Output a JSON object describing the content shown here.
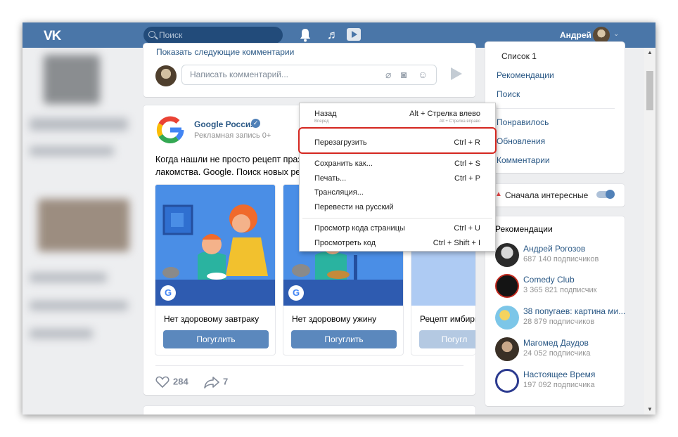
{
  "header": {
    "logo": "VK",
    "search_placeholder": "Поиск",
    "user_name": "Андрей"
  },
  "feed": {
    "show_more_comments": "Показать следующие комментарии",
    "comment_placeholder": "Написать комментарий...",
    "post": {
      "author": "Google Россия",
      "subtitle": "Рекламная запись 0+",
      "text_line1": "Когда нашли не просто рецепт праздни",
      "text_line2": "лакомства. Google. Поиск новых рецеп",
      "tiles": [
        {
          "title": "Нет здоровому завтраку",
          "button": "Погуглить"
        },
        {
          "title": "Нет здоровому ужину",
          "button": "Погуглить"
        },
        {
          "title": "Рецепт имбирн",
          "button": "Погугл"
        }
      ],
      "likes": "284",
      "shares": "7"
    }
  },
  "right_nav": {
    "items_top": [
      "Список 1",
      "Рекомендации",
      "Поиск"
    ],
    "items_bottom": [
      "Понравилось",
      "Обновления",
      "Комментарии"
    ]
  },
  "filter": {
    "label": "Сначала интересные"
  },
  "recommendations": {
    "title": "Рекомендации",
    "items": [
      {
        "name": "Андрей Рогозов",
        "subs": "687 140 подписчиков"
      },
      {
        "name": "Comedy Club",
        "subs": "3 365 821 подписчик"
      },
      {
        "name": "38 попугаев: картина ми...",
        "subs": "28 879 подписчиков"
      },
      {
        "name": "Магомед Даудов",
        "subs": "24 052 подписчика"
      },
      {
        "name": "Настоящее Время",
        "subs": "197 092 подписчика"
      }
    ]
  },
  "context_menu": {
    "items": [
      {
        "label": "Назад",
        "key": "Alt + Стрелка влево"
      },
      {
        "label": "Вперед",
        "key": "Alt + Стрелка вправо"
      },
      {
        "label": "Перезагрузить",
        "key": "Ctrl + R"
      },
      {
        "label": "Сохранить как...",
        "key": "Ctrl + S"
      },
      {
        "label": "Печать...",
        "key": "Ctrl + P"
      },
      {
        "label": "Трансляция...",
        "key": ""
      },
      {
        "label": "Перевести на русский",
        "key": ""
      },
      {
        "label": "Просмотр кода страницы",
        "key": "Ctrl + U"
      },
      {
        "label": "Просмотреть код",
        "key": "Ctrl + Shift + I"
      }
    ]
  },
  "colors": {
    "header": "#4a76a8",
    "link": "#2a5885",
    "button": "#5b88bd",
    "highlight": "#d4261f"
  }
}
